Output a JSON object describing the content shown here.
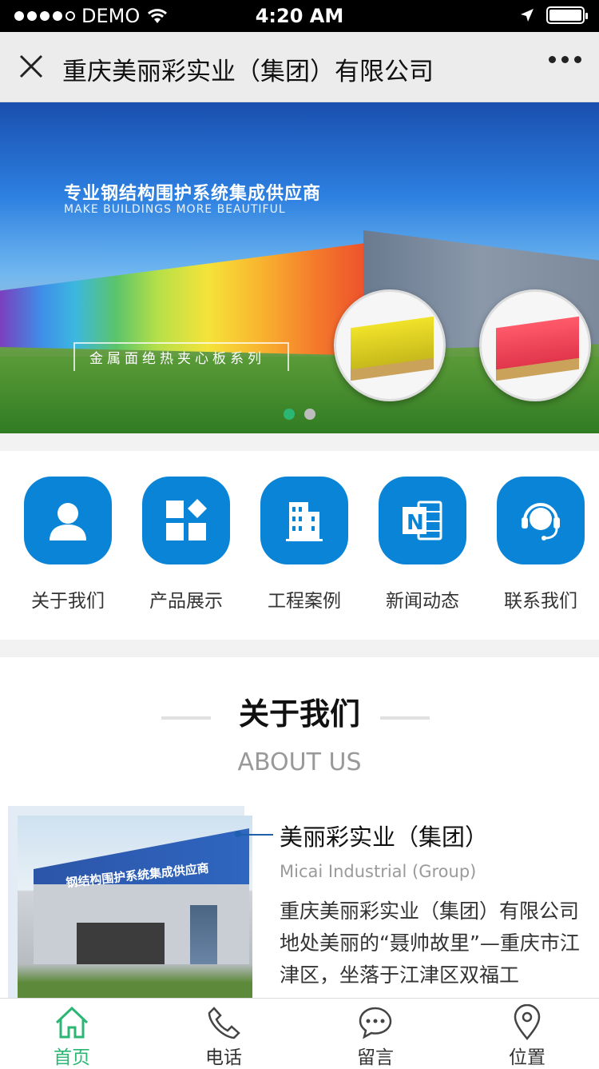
{
  "status_bar": {
    "carrier": "DEMO",
    "time": "4:20 AM"
  },
  "nav": {
    "title": "重庆美丽彩实业（集团）有限公司"
  },
  "banner": {
    "headline": "专业钢结构围护系统集成供应商",
    "subline": "MAKE BUILDINGS MORE BEAUTIFUL",
    "series_label": "金属面绝热夹心板系列",
    "slides": 2,
    "active_slide": 1
  },
  "quick_links": [
    {
      "label": "关于我们",
      "icon": "user-icon"
    },
    {
      "label": "产品展示",
      "icon": "grid-icon"
    },
    {
      "label": "工程案例",
      "icon": "building-icon"
    },
    {
      "label": "新闻动态",
      "icon": "onenote-icon"
    },
    {
      "label": "联系我们",
      "icon": "headset-icon"
    }
  ],
  "about": {
    "title": "关于我们",
    "subtitle": "ABOUT US",
    "company_name": "美丽彩实业（集团）",
    "company_en": "Micai Industrial (Group)",
    "description": "重庆美丽彩实业（集团）有限公司地处美丽的“聂帅故里”—重庆市江津区，坐落于江津区双福工",
    "image_sign": "钢结构围护系统集成供应商"
  },
  "tabbar": [
    {
      "label": "首页",
      "icon": "home-icon",
      "active": true
    },
    {
      "label": "电话",
      "icon": "phone-icon",
      "active": false
    },
    {
      "label": "留言",
      "icon": "message-icon",
      "active": false
    },
    {
      "label": "位置",
      "icon": "location-icon",
      "active": false
    }
  ],
  "colors": {
    "brand_blue": "#0a84d6",
    "active_green": "#2bb673",
    "underline_blue": "#9fc3ef"
  }
}
